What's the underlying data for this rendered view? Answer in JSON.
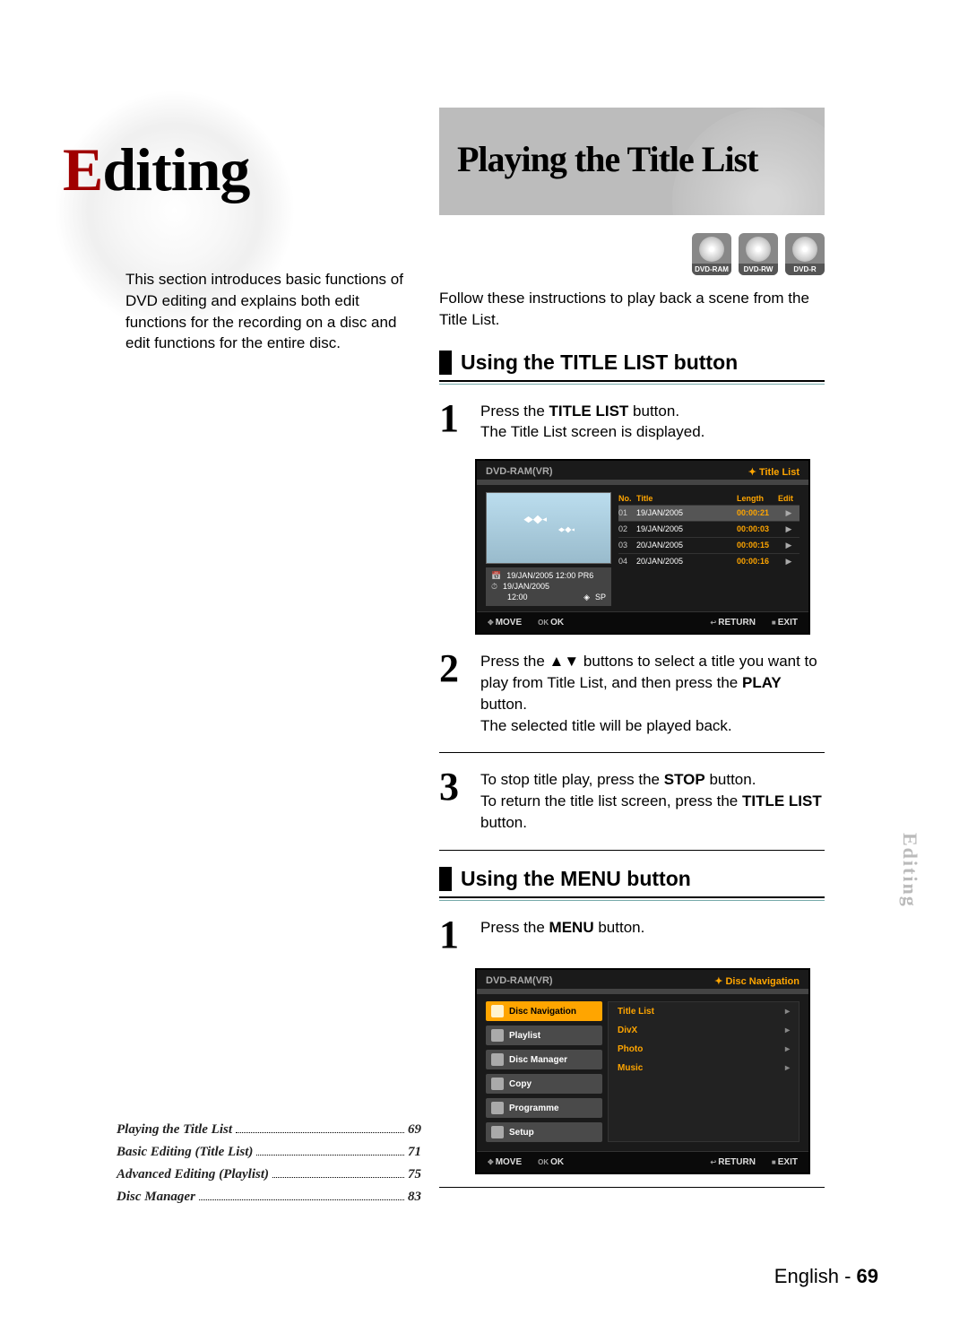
{
  "chapter": {
    "first_letter": "E",
    "rest": "diting",
    "intro": "This section introduces basic functions of DVD editing and explains both edit functions for the recording on a disc and edit functions for the entire disc."
  },
  "toc": [
    {
      "title": "Playing the Title List",
      "page": "69"
    },
    {
      "title": "Basic Editing (Title List)",
      "page": "71"
    },
    {
      "title": "Advanced Editing (Playlist)",
      "page": "75"
    },
    {
      "title": "Disc Manager",
      "page": "83"
    }
  ],
  "article": {
    "title": "Playing the Title List",
    "disc_badges": [
      "DVD-RAM",
      "DVD-RW",
      "DVD-R"
    ],
    "lead": "Follow these instructions to play back a scene from the Title List.",
    "section1_head": "Using the TITLE LIST button",
    "section2_head": "Using the MENU button",
    "step1_a": "Press the ",
    "step1_bold": "TITLE LIST",
    "step1_b": " button.",
    "step1_line2": "The Title List screen is displayed.",
    "step2_a": "Press the ▲▼ buttons to select a title you want to play from Title List, and then press the ",
    "step2_bold": "PLAY",
    "step2_b": " button.",
    "step2_line2": "The selected title will be played back.",
    "step3_a": "To stop title play, press the ",
    "step3_bold": "STOP",
    "step3_b": " button.",
    "step3_line2a": "To return the title list screen, press the ",
    "step3_line2_bold": "TITLE LIST",
    "step3_line2b": " button.",
    "sec2_step1_a": "Press the ",
    "sec2_step1_bold": "MENU",
    "sec2_step1_b": " button."
  },
  "screen_tl": {
    "top_left": "DVD-RAM(VR)",
    "top_right": "Title List",
    "info": {
      "line1_icon": "📅",
      "line1": "19/JAN/2005  12:00      PR6",
      "line2_icon": "⏱",
      "line2": "19/JAN/2005",
      "line3_left": "12:00",
      "line3_right": "SP"
    },
    "cols": [
      "No.",
      "Title",
      "Length",
      "Edit"
    ],
    "rows": [
      {
        "no": "01",
        "title": "19/JAN/2005",
        "len": "00:00:21",
        "edit": "▶",
        "sel": true
      },
      {
        "no": "02",
        "title": "19/JAN/2005",
        "len": "00:00:03",
        "edit": "▶"
      },
      {
        "no": "03",
        "title": "20/JAN/2005",
        "len": "00:00:15",
        "edit": "▶"
      },
      {
        "no": "04",
        "title": "20/JAN/2005",
        "len": "00:00:16",
        "edit": "▶"
      }
    ],
    "bottom": {
      "move": "MOVE",
      "ok": "OK",
      "ret": "RETURN",
      "exit": "EXIT"
    }
  },
  "screen_dn": {
    "top_left": "DVD-RAM(VR)",
    "top_right": "Disc Navigation",
    "left_menu": [
      {
        "label": "Disc Navigation",
        "sel": true
      },
      {
        "label": "Playlist"
      },
      {
        "label": "Disc Manager"
      },
      {
        "label": "Copy"
      },
      {
        "label": "Programme"
      },
      {
        "label": "Setup"
      }
    ],
    "right_menu": [
      "Title List",
      "DivX",
      "Photo",
      "Music"
    ],
    "bottom": {
      "move": "MOVE",
      "ok": "OK",
      "ret": "RETURN",
      "exit": "EXIT"
    }
  },
  "side_tab": "Editing",
  "footer": {
    "lang": "English - ",
    "page": "69"
  }
}
